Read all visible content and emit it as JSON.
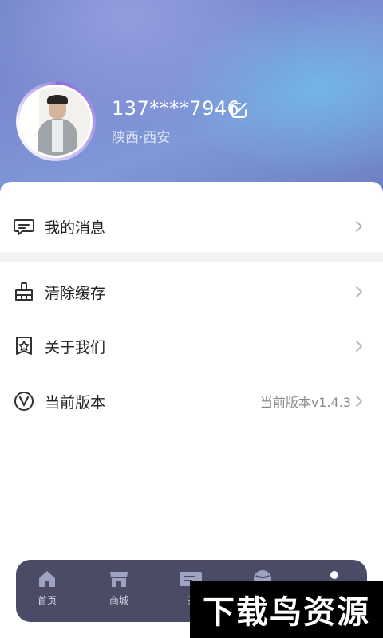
{
  "profile": {
    "phone": "137****7946",
    "location": "陕西·西安"
  },
  "menu": [
    {
      "label": "我的消息",
      "icon": "message-icon"
    },
    {
      "label": "清除缓存",
      "icon": "broom-icon"
    },
    {
      "label": "关于我们",
      "icon": "star-badge-icon"
    },
    {
      "label": "当前版本",
      "icon": "version-v-icon",
      "value": "当前版本v1.4.3"
    }
  ],
  "tabbar": {
    "tabs": [
      {
        "label": "首页",
        "icon": "home-icon"
      },
      {
        "label": "商城",
        "icon": "store-icon"
      },
      {
        "label": "日",
        "icon": "ticket-icon"
      },
      {
        "label": "",
        "icon": "globe-icon"
      },
      {
        "label": "",
        "icon": "user-icon"
      }
    ]
  },
  "watermark": {
    "text": "下载鸟资源"
  },
  "colors": {
    "tabbar_bg": "#4a4c66",
    "header_blue": "#7c8bd2",
    "text_primary": "#222222",
    "text_secondary": "#8a8a8a"
  }
}
